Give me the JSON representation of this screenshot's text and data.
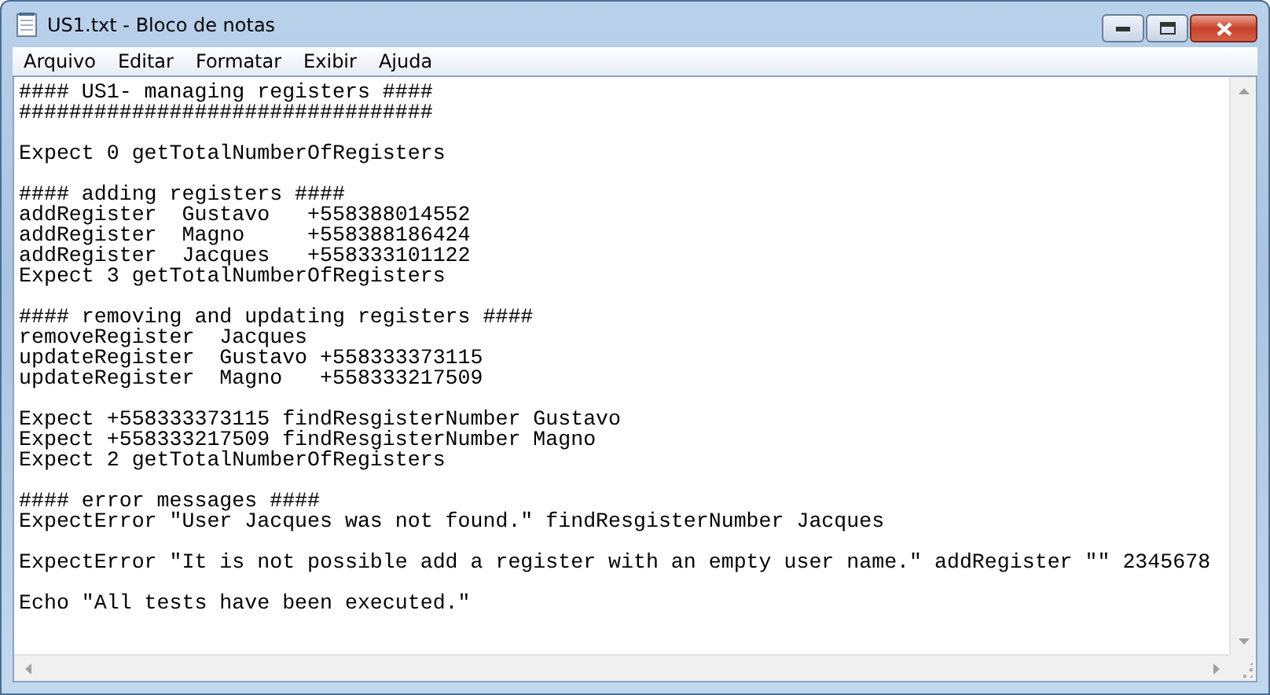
{
  "window": {
    "title": "US1.txt - Bloco de notas"
  },
  "menu": [
    "Arquivo",
    "Editar",
    "Formatar",
    "Exibir",
    "Ajuda"
  ],
  "document": {
    "blocks": [
      [
        "#### US1- managing registers ####",
        "#################################"
      ],
      [
        "Expect 0 getTotalNumberOfRegisters"
      ],
      [
        "#### adding registers ####",
        "addRegister  Gustavo   +558388014552",
        "addRegister  Magno     +558388186424",
        "addRegister  Jacques   +558333101122",
        "Expect 3 getTotalNumberOfRegisters"
      ],
      [
        "#### removing and updating registers ####",
        "removeRegister  Jacques",
        "updateRegister  Gustavo +558333373115",
        "updateRegister  Magno   +558333217509"
      ],
      [
        "Expect +558333373115 findResgisterNumber Gustavo",
        "Expect +558333217509 findResgisterNumber Magno",
        "Expect 2 getTotalNumberOfRegisters"
      ],
      [
        "#### error messages ####",
        "ExpectError \"User Jacques was not found.\" findResgisterNumber Jacques"
      ],
      [
        "ExpectError \"It is not possible add a register with an empty user name.\" addRegister \"\" 2345678"
      ],
      [
        "Echo \"All tests have been executed.\""
      ]
    ]
  }
}
